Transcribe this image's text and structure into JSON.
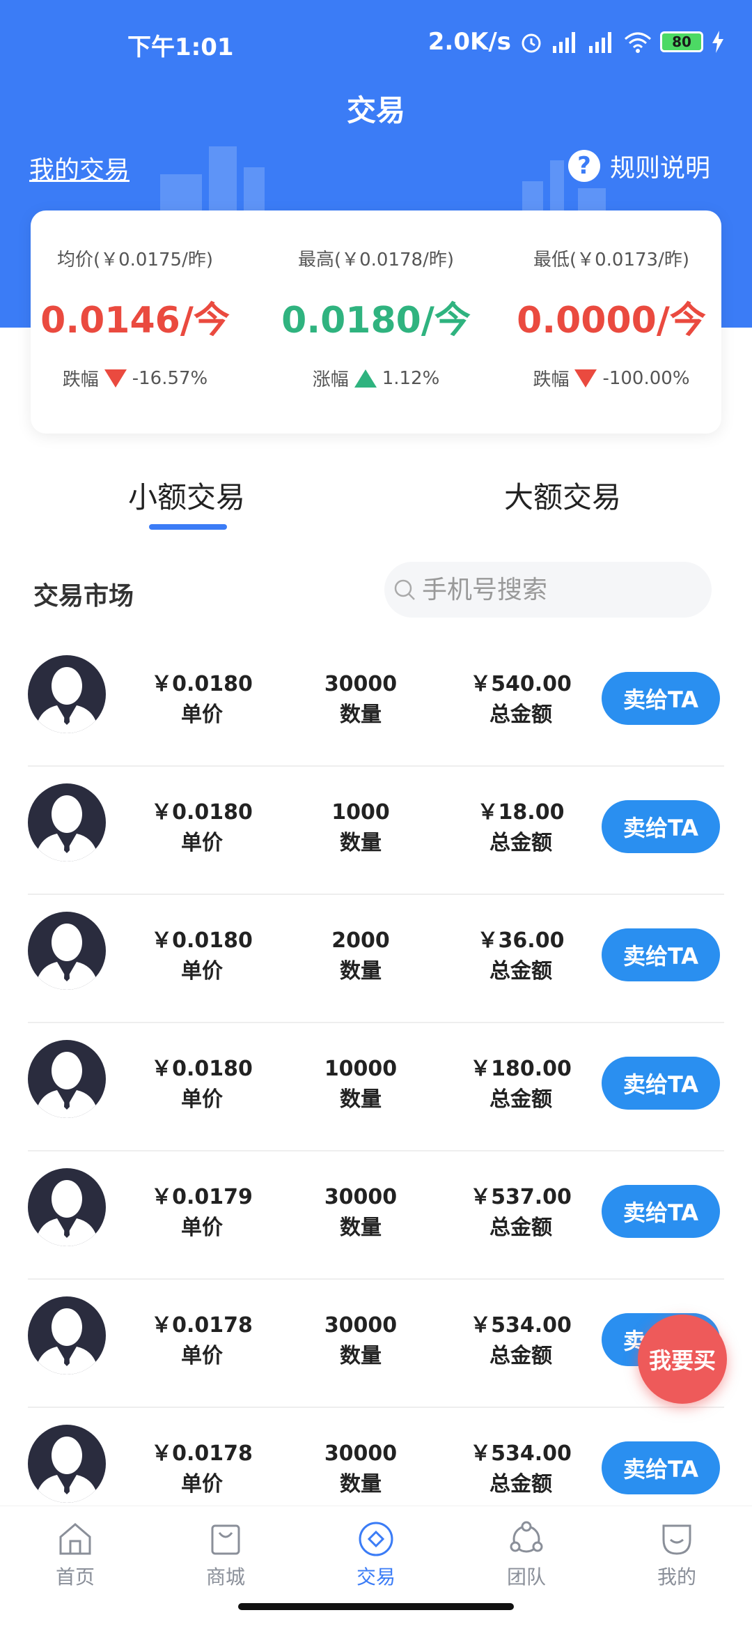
{
  "statusbar": {
    "time": "下午1:01",
    "speed": "2.0K/s",
    "battery": "80"
  },
  "header": {
    "title": "交易",
    "my_trade": "我的交易",
    "rules": "规则说明"
  },
  "stats": [
    {
      "label": "均价(￥0.0175/昨)",
      "value": "0.0146/今",
      "change_label": "跌幅",
      "change": "-16.57%",
      "direction": "down"
    },
    {
      "label": "最高(￥0.0178/昨)",
      "value": "0.0180/今",
      "change_label": "涨幅",
      "change": "1.12%",
      "direction": "up"
    },
    {
      "label": "最低(￥0.0173/昨)",
      "value": "0.0000/今",
      "change_label": "跌幅",
      "change": "-100.00%",
      "direction": "down"
    }
  ],
  "tabs": {
    "small": "小额交易",
    "large": "大额交易"
  },
  "market": {
    "title": "交易市场",
    "search_placeholder": "手机号搜索"
  },
  "labels": {
    "unit_price": "单价",
    "quantity": "数量",
    "total": "总金额",
    "sell": "卖给TA"
  },
  "orders": [
    {
      "price": "￥0.0180",
      "qty": "30000",
      "total": "￥540.00"
    },
    {
      "price": "￥0.0180",
      "qty": "1000",
      "total": "￥18.00"
    },
    {
      "price": "￥0.0180",
      "qty": "2000",
      "total": "￥36.00"
    },
    {
      "price": "￥0.0180",
      "qty": "10000",
      "total": "￥180.00"
    },
    {
      "price": "￥0.0179",
      "qty": "30000",
      "total": "￥537.00"
    },
    {
      "price": "￥0.0178",
      "qty": "30000",
      "total": "￥534.00"
    },
    {
      "price": "￥0.0178",
      "qty": "30000",
      "total": "￥534.00"
    }
  ],
  "fab": "我要买",
  "tabbar": {
    "home": "首页",
    "mall": "商城",
    "trade": "交易",
    "team": "团队",
    "mine": "我的"
  },
  "colors": {
    "primary": "#3b7cf6",
    "sell_button": "#2a8ff0",
    "down": "#ea4a3f",
    "up": "#2fb37f",
    "fab": "#ee5a5a"
  }
}
